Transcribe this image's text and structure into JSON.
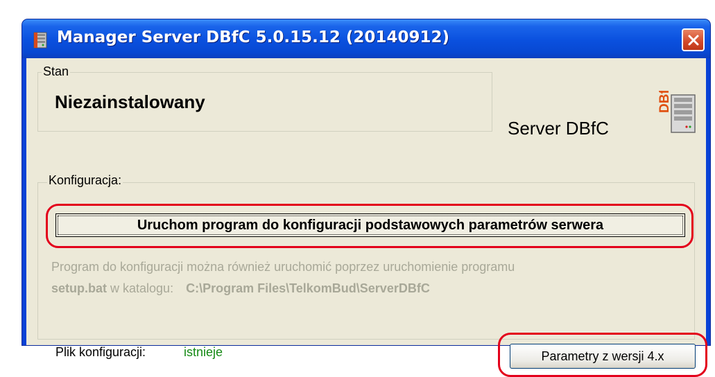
{
  "window": {
    "title": "Manager Server DBfC 5.0.15.12 (20140912)",
    "icon": "dbfc-app-icon",
    "close_icon": "close-icon"
  },
  "stan": {
    "legend": "Stan",
    "value": "Niezainstalowany"
  },
  "branding": {
    "label": "Server DBfC",
    "logo_text": "DBfC",
    "logo_icon": "server-tower-icon"
  },
  "konfiguracja": {
    "legend": "Konfiguracja:",
    "run_button_label": "Uruchom program do konfiguracji podstawowych parametrów serwera",
    "info_line1": "Program do konfiguracji można również uruchomić poprzez  uruchomienie programu",
    "info_line2_file": "setup.bat",
    "info_line2_mid": " w katalogu:",
    "info_line2_path": "C:\\Program Files\\TelkomBud\\ServerDBfC"
  },
  "plik": {
    "label": "Plik konfiguracji:",
    "value": "istnieje"
  },
  "params_button_label": "Parametry z wersji 4.x",
  "colors": {
    "titlebar": "#0a50de",
    "client": "#ece9d8",
    "highlight": "#e3001b",
    "status_ok": "#158a15",
    "disabled_text": "#a8a898"
  }
}
